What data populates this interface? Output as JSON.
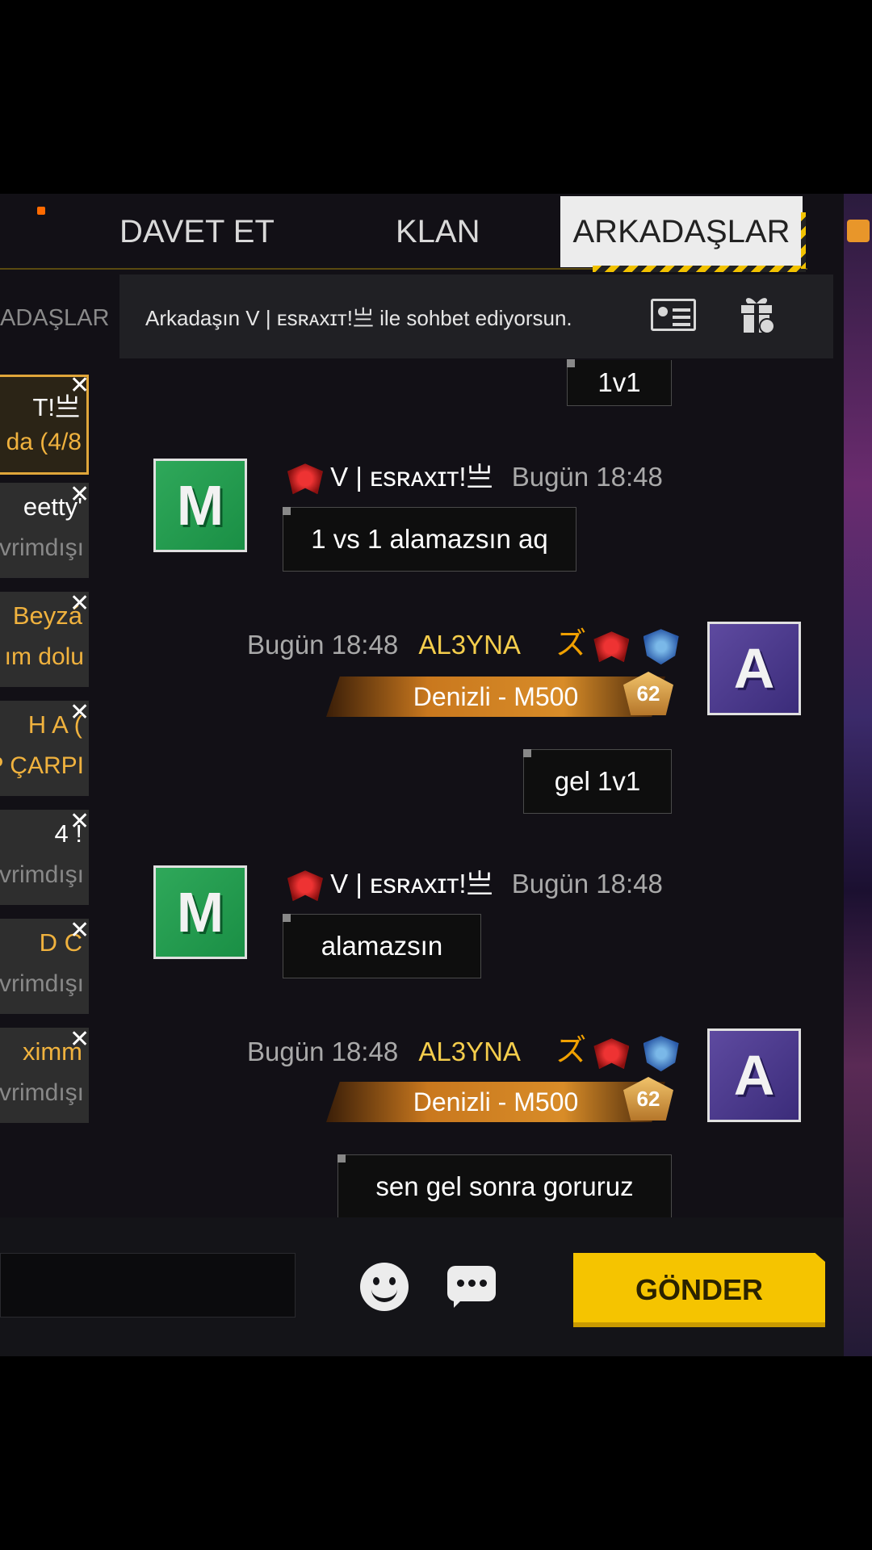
{
  "tabs": {
    "invite": "DAVET ET",
    "clan": "KLAN",
    "friends": "ARKADAŞLAR"
  },
  "sidebar": {
    "label": "ADAŞLAR",
    "friends": [
      {
        "line1": "T!亗",
        "line2": "da (4/8",
        "state": "active"
      },
      {
        "line1": "eetty'",
        "line2": "vrimdışı",
        "state": "offline"
      },
      {
        "line1": "Beyzá",
        "line2": "ım dolu",
        "state": "online"
      },
      {
        "line1": "H A (",
        "line2": "P ÇARPI",
        "state": "online"
      },
      {
        "line1": "4 !",
        "line2": "vrimdışı",
        "state": "offline"
      },
      {
        "line1": "D C",
        "line2": "vrimdışı",
        "state": "offline"
      },
      {
        "line1": "ximm",
        "line2": "vrimdışı",
        "state": "offline"
      }
    ],
    "close_glyph": "✕"
  },
  "chat_header": {
    "text": "Arkadaşın V | ᴇsʀᴀxɪᴛ!亗 ile sohbet ediyorsun."
  },
  "messages": {
    "m0_text": "1v1",
    "m1": {
      "sender": "V | ᴇsʀᴀxɪᴛ!亗",
      "time": "Bugün 18:48",
      "text": "1 vs 1 alamazsın aq",
      "avatar": "M"
    },
    "m2": {
      "time": "Bugün 18:48",
      "sender": "AL3YNA",
      "tag": "ズ",
      "banner": "Denizli - M500",
      "level": "62",
      "avatar": "A",
      "text": "gel 1v1"
    },
    "m3": {
      "sender": "V | ᴇsʀᴀxɪᴛ!亗",
      "time": "Bugün 18:48",
      "text": "alamazsın",
      "avatar": "M"
    },
    "m4": {
      "time": "Bugün 18:48",
      "sender": "AL3YNA",
      "tag": "ズ",
      "banner": "Denizli - M500",
      "level": "62",
      "avatar": "A",
      "text": "sen gel sonra goruruz"
    }
  },
  "input": {
    "value": ""
  },
  "send_button": "GÖNDER",
  "icons": [
    "profile-card-icon",
    "gift-icon",
    "emoji-icon",
    "chat-bubble-icon",
    "close-icon"
  ]
}
